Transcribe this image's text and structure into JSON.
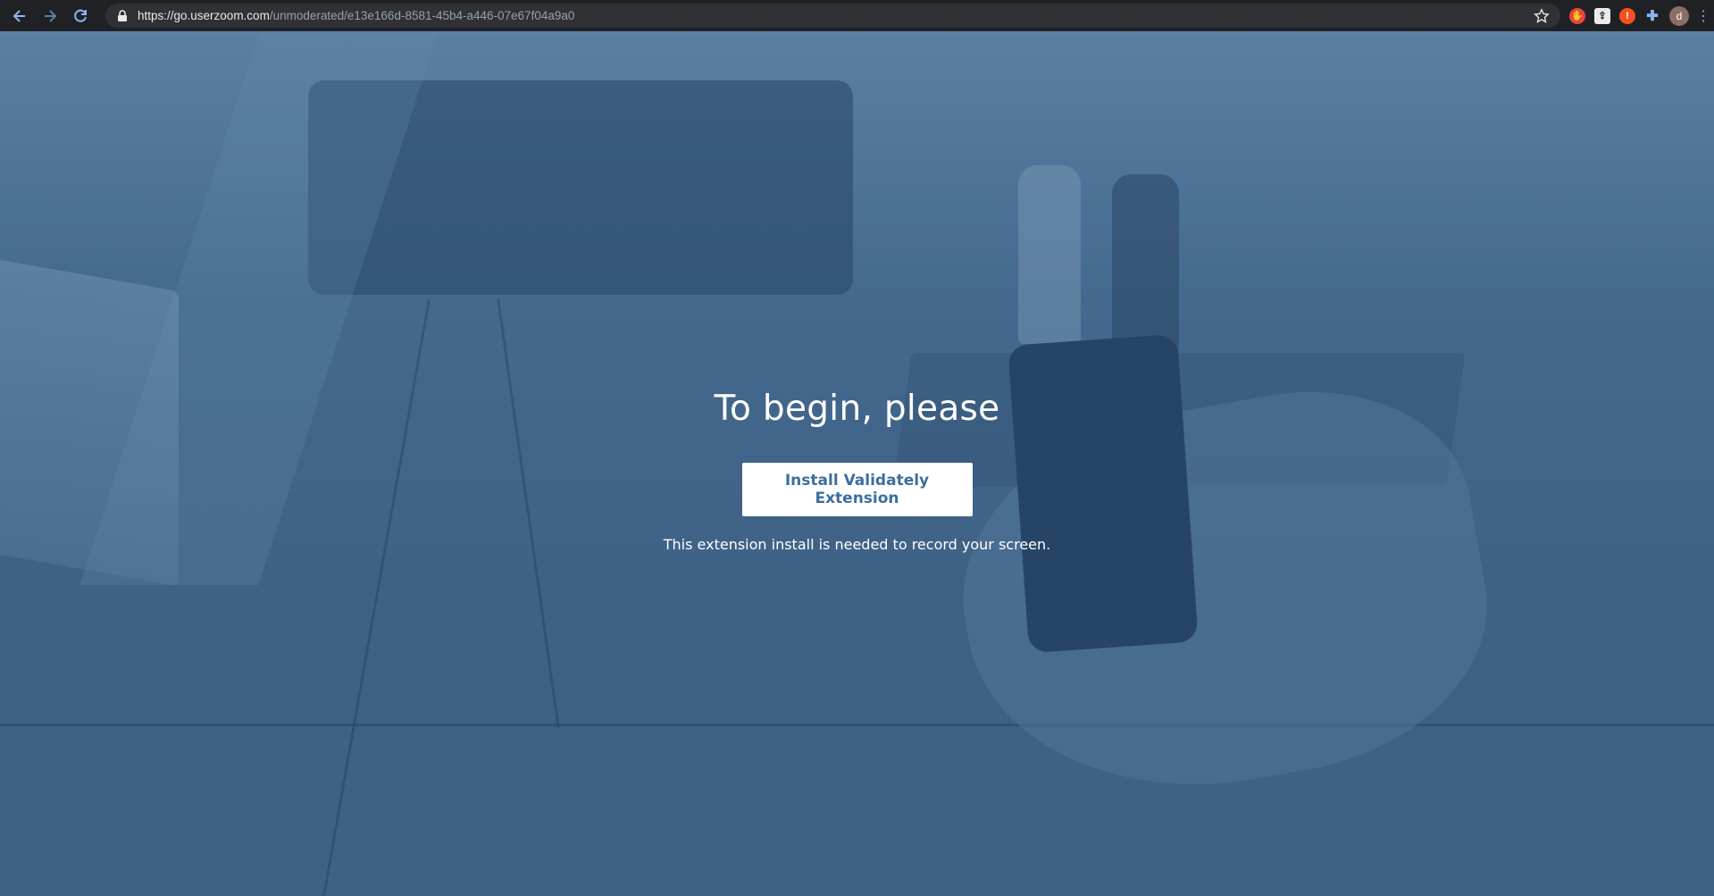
{
  "browser": {
    "url_host": "https://go.userzoom.com",
    "url_path": "/unmoderated/e13e166d-8581-45b4-a446-07e67f04a9a0",
    "back_icon": "arrow-left-icon",
    "forward_icon": "arrow-right-icon",
    "reload_icon": "reload-icon",
    "lock_icon": "lock-icon",
    "star_icon": "star-icon",
    "extensions": [
      "adblock-icon",
      "extension-white-icon",
      "alert-extension-icon",
      "puzzle-icon"
    ],
    "avatar_letter": "d",
    "menu_icon": "kebab-menu-icon"
  },
  "main": {
    "heading": "To begin, please",
    "install_button": "Install Validately Extension",
    "note": "This extension install is needed to record your screen."
  },
  "colors": {
    "toolbar_bg": "#202124",
    "page_overlay": "#4a6f94",
    "button_text": "#3c6e9e"
  }
}
